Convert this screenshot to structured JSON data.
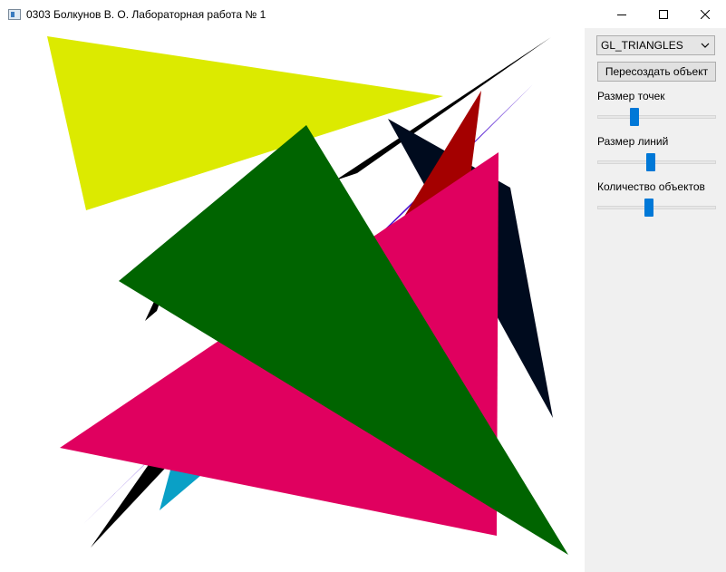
{
  "window": {
    "title": "0303 Болкунов В. О. Лабораторная работа № 1",
    "controls": [
      "minimize",
      "maximize",
      "close"
    ]
  },
  "panel": {
    "primitive_select": {
      "value": "GL_TRIANGLES",
      "options": [
        "GL_TRIANGLES"
      ]
    },
    "recreate_button": "Пересоздать объект",
    "sliders": [
      {
        "label": "Размер точек",
        "value": 0.3
      },
      {
        "label": "Размер линий",
        "value": 0.45
      },
      {
        "label": "Количество объектов",
        "value": 0.43
      }
    ]
  },
  "scene": {
    "background": "#ffffff",
    "colors": {
      "yellow": "#dcea00",
      "black": "#000000",
      "navy": "#000b1e",
      "purple": "#4a0ed0",
      "dark_red": "#a40000",
      "magenta": "#e0005f",
      "cyan": "#0aa0c6",
      "green": "#006400"
    }
  }
}
